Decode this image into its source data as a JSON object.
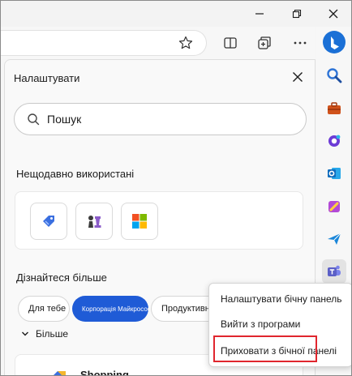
{
  "window": {
    "minimize_icon": "minimize-icon",
    "restore_icon": "restore-icon",
    "close_icon": "close-icon"
  },
  "toolbar": {
    "favorite_icon": "star-icon",
    "split_icon": "split-screen-icon",
    "collections_icon": "collections-icon",
    "more_icon": "more-dots-icon"
  },
  "rail": {
    "items": [
      {
        "name": "bing-copilot",
        "icon": "bing-icon",
        "color": "#1b70d6"
      },
      {
        "name": "search",
        "icon": "search-icon",
        "color": "#2e74d6"
      },
      {
        "name": "tools",
        "icon": "toolbox-icon",
        "color": "#d0521b"
      },
      {
        "name": "games",
        "icon": "games-icon",
        "color": "#6c3bd6"
      },
      {
        "name": "outlook",
        "icon": "outlook-icon",
        "color": "#0f6cbd"
      },
      {
        "name": "designer",
        "icon": "designer-icon",
        "color": "#8a3ad6"
      },
      {
        "name": "send",
        "icon": "send-icon",
        "color": "#1a86d9"
      },
      {
        "name": "teams",
        "icon": "teams-icon",
        "color": "#5b5fc7"
      }
    ]
  },
  "panel": {
    "title": "Налаштувати",
    "close_icon": "close-icon",
    "search": {
      "placeholder": "Пошук",
      "value": ""
    },
    "recent_title": "Нещодавно використані",
    "recent_apps": [
      {
        "name": "shopping",
        "icon": "tag-icon"
      },
      {
        "name": "chess",
        "icon": "chess-icon"
      },
      {
        "name": "microsoft",
        "icon": "microsoft-logo-icon"
      }
    ],
    "learn_title": "Дізнайтеся більше",
    "chips": [
      {
        "label": "Для тебе",
        "selected": false
      },
      {
        "label": "Корпорація Майкрософт",
        "selected": true
      },
      {
        "label": "Продуктивність",
        "selected": false
      }
    ],
    "more_label": "Більше",
    "shopping_label": "Shopping"
  },
  "context_menu": {
    "items": [
      "Налаштувати бічну панель",
      "Вийти з програми",
      "Приховати з бічної панелі"
    ],
    "highlight_color": "#e0262e"
  },
  "colors": {
    "accent": "#1f5bd6"
  }
}
